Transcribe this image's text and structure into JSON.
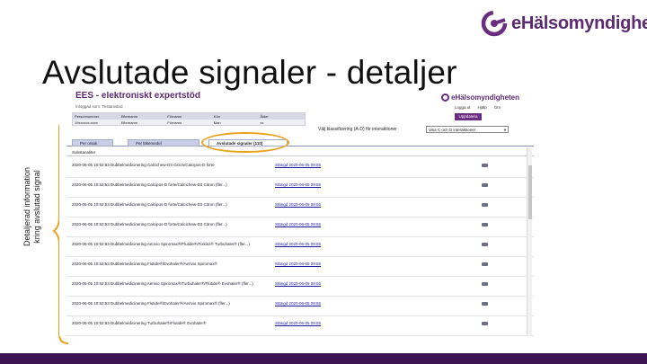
{
  "logo": {
    "text": "eHälsomyndigheten",
    "icon": "ehalsomyndigheten-logo-icon",
    "color": "#5b2a70"
  },
  "slide": {
    "title": "Avslutade signaler - detaljer",
    "side_label_line1": "Detaljerad information",
    "side_label_line2": "kring avslutad signal",
    "accent": "#e8a21e",
    "footer_color": "#3d1552"
  },
  "app": {
    "title": "EES - elektroniskt expertstöd",
    "subtitle": "Inloggad som: Testanvänd",
    "logo_text": "eHälsomyndigheten",
    "toplinks": [
      "Logga ut",
      "Hjälp",
      "Om"
    ],
    "patient_headers": [
      "Personnummer",
      "Efternamn",
      "Förnamn",
      "Kön",
      "Ålder"
    ],
    "patient_values": [
      "19xxxxxx-xxxx",
      "Efternamn",
      "Förnamn",
      "Man",
      "xx"
    ],
    "update_button": "Uppdatera",
    "filter_label": "Välj klassificering (A-D) för interaktioner",
    "filter_value": "Visa C och D interaktioner",
    "tabs": [
      "Per orsak",
      "Per läkemedel",
      "Avslutade signaler (110)"
    ],
    "active_tab": 2,
    "list_header": "Substanaliter",
    "rows": [
      {
        "desc": "2020-06-05 10:52:53 Dubbelmedicinering Calcichew-D3 Citron/Calcipos-D forte",
        "status": "Stängd 2020-06-05 09:55"
      },
      {
        "desc": "2020-06-05 10:52:53 Dubbelmedicinering Calcipos-D forte/Calcichew-D3 Citron (fler...)",
        "status": "Stängd 2020-06-05 09:55"
      },
      {
        "desc": "2020-06-05 10:52:53 Dubbelmedicinering Calcipos-D forte/Calcichew-D3 Citron (fler...)",
        "status": "Stängd 2020-06-05 09:55"
      },
      {
        "desc": "2020-06-05 10:52:53 Dubbelmedicinering Calcipos-D forte/Calcichew-D3 Citron (fler...)",
        "status": "Stängd 2020-06-05 09:55"
      },
      {
        "desc": "2020-06-05 10:52:53 Dubbelmedicinering Aerivio Spiromax®/Flutide®/Fixkinz® Turbuhaler® (fler...)",
        "status": "Stängd 2020-06-05 09:55"
      },
      {
        "desc": "2020-06-05 10:52:53 Dubbelmedicinering Flutide®/Evohaler®/Aerivio Spiromax®",
        "status": "Stängd 2020-06-05 09:55"
      },
      {
        "desc": "2020-06-05 10:52:53 Dubbelmedicinering Aerivio Spiromax®/Turbuhaler®/Flutide® Evohaler® (fler...)",
        "status": "Stängd 2020-06-05 09:55"
      },
      {
        "desc": "2020-06-05 10:52:53 Dubbelmedicinering Flutide®/Evohaler®/Aerivio Spiromax® (fler...)",
        "status": "Stängd 2020-06-05 09:55"
      },
      {
        "desc": "2020-06-05 10:52:53 Dubbelmedicinering Turbuhaler®/Flutide® Evohaler®",
        "status": "Stängd 2020-06-05 09:55"
      }
    ]
  }
}
